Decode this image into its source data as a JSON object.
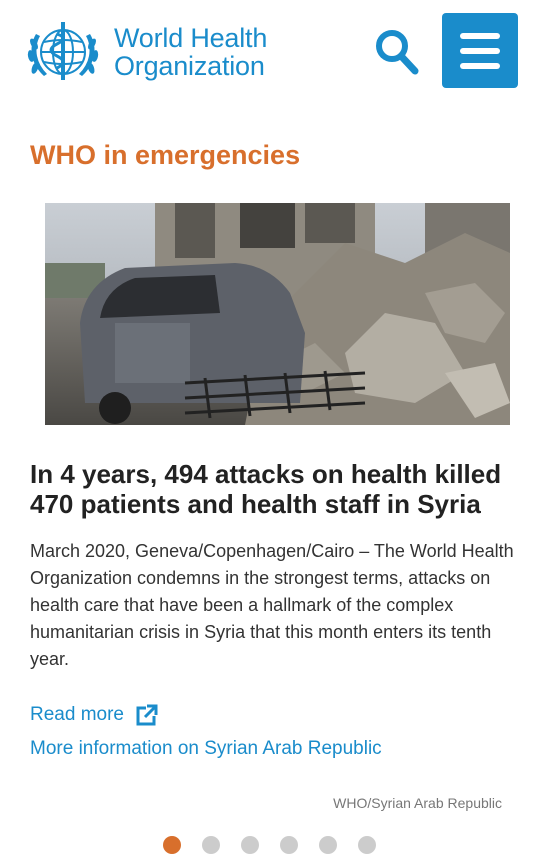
{
  "header": {
    "logo_line1": "World Health",
    "logo_line2": "Organization",
    "brand_color": "#1a8ccb",
    "search_icon": "search-icon",
    "menu_icon": "hamburger-menu-icon"
  },
  "main": {
    "section_title": "WHO in emergencies",
    "section_title_color": "#d86f2c",
    "headline": "In 4 years, 494 attacks on health killed 470 patients and health staff in Syria",
    "body": "March 2020, Geneva/Copenhagen/Cairo – The World Health Organization condemns in the strongest terms, attacks on health care that have been a hallmark of the complex humanitarian crisis in Syria that this month enters its tenth year.",
    "read_more_label": "Read more",
    "read_more_icon": "external-link-icon",
    "more_info_label": "More information on Syrian Arab Republic",
    "photo_credit": "WHO/Syrian Arab Republic"
  },
  "carousel": {
    "total_slides": 6,
    "active_slide": 1,
    "active_color": "#d86f2c",
    "inactive_color": "#cccccc"
  }
}
